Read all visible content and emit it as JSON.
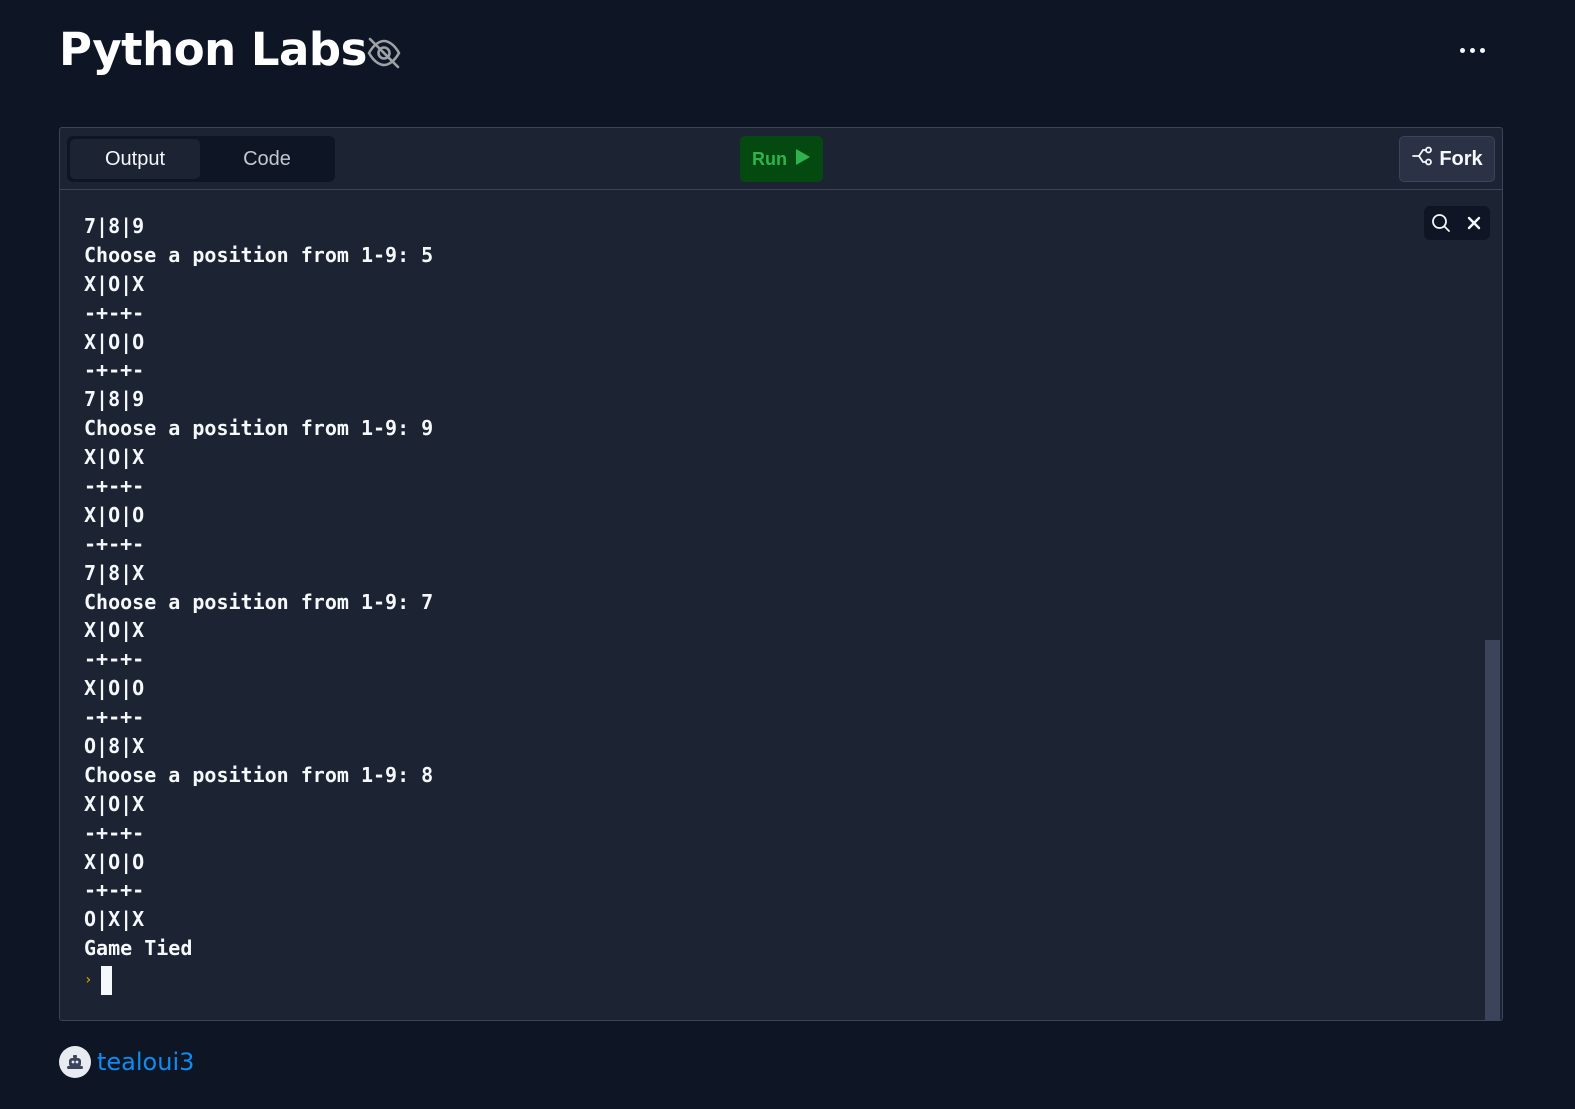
{
  "header": {
    "title": "Python Labs",
    "visibility_icon": "eye-off-icon",
    "more_icon": "more-horizontal-icon"
  },
  "toolbar": {
    "tabs": [
      {
        "label": "Output",
        "active": true
      },
      {
        "label": "Code",
        "active": false
      }
    ],
    "run_label": "Run",
    "run_icon": "play-icon",
    "fork_label": "Fork",
    "fork_icon": "fork-icon"
  },
  "console": {
    "lines": [
      "7|8|9",
      "Choose a position from 1-9: 5",
      "X|O|X",
      "-+-+-",
      "X|O|O",
      "-+-+-",
      "7|8|9",
      "Choose a position from 1-9: 9",
      "X|O|X",
      "-+-+-",
      "X|O|O",
      "-+-+-",
      "7|8|X",
      "Choose a position from 1-9: 7",
      "X|O|X",
      "-+-+-",
      "X|O|O",
      "-+-+-",
      "O|8|X",
      "Choose a position from 1-9: 8",
      "X|O|X",
      "-+-+-",
      "X|O|O",
      "-+-+-",
      "O|X|X",
      "Game Tied"
    ],
    "prompt": "›",
    "tools": {
      "search_icon": "search-icon",
      "close_icon": "close-icon"
    }
  },
  "author": {
    "name": "tealoui3",
    "avatar_icon": "avatar-icon"
  },
  "colors": {
    "background": "#0e1525",
    "panel": "#1c2333",
    "border": "#3c445c",
    "run_bg": "#044a10",
    "run_fg": "#2fb34f",
    "link": "#0f8cf0",
    "prompt": "#c99a00"
  }
}
